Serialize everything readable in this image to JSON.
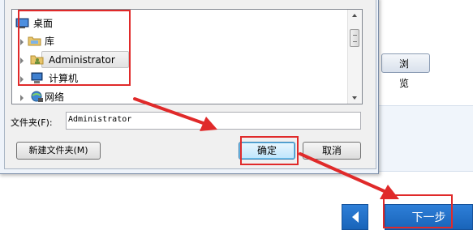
{
  "background": {
    "browse_button": "浏 览",
    "back_icon": "chevron-left-icon",
    "next_button": "下一步"
  },
  "dialog": {
    "tree_items": [
      {
        "label": "桌面",
        "icon": "desktop-icon"
      },
      {
        "label": "库",
        "icon": "library-folder-icon"
      },
      {
        "label": "Administrator",
        "icon": "user-folder-icon",
        "selected": true
      },
      {
        "label": "计算机",
        "icon": "computer-icon"
      },
      {
        "label": "网络",
        "icon": "network-icon"
      }
    ],
    "folder_label": "文件夹(F):",
    "folder_value": "Administrator",
    "new_folder_button": "新建文件夹(M)",
    "ok_button": "确定",
    "cancel_button": "取消"
  },
  "colors": {
    "annotation_red": "#e02a2a",
    "primary_blue": "#1f6fc9"
  }
}
